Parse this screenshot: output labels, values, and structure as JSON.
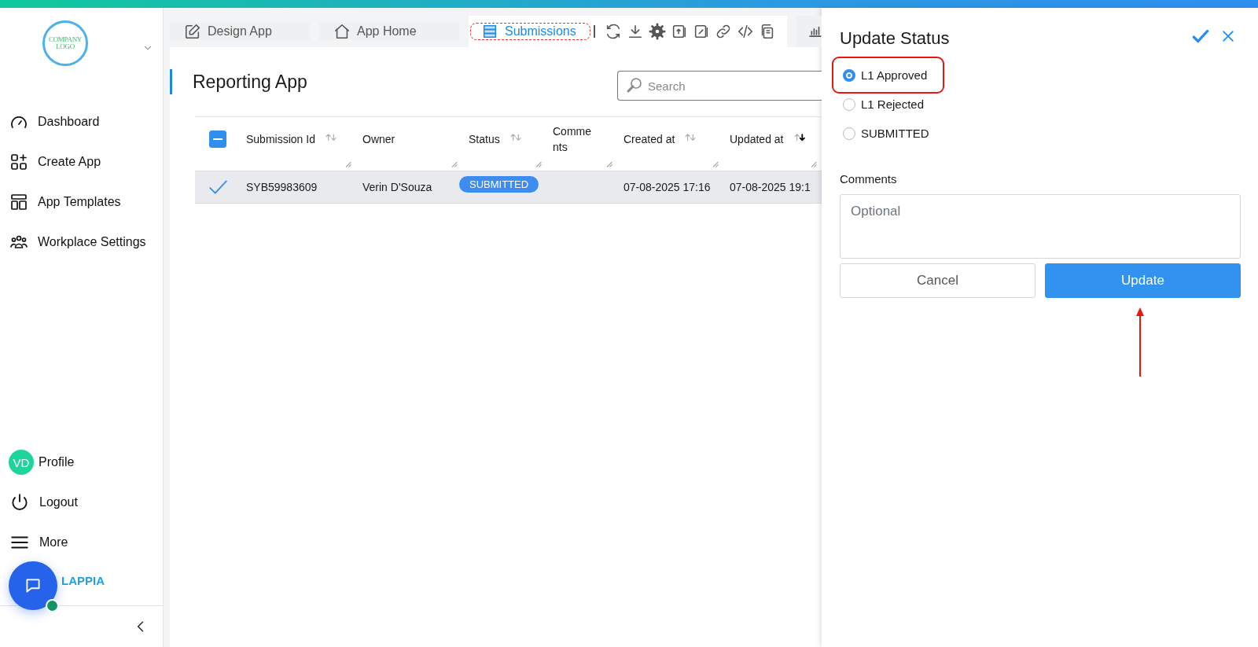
{
  "sidebar": {
    "logo_text": "COMPANY LOGO",
    "nav": [
      {
        "label": "Dashboard"
      },
      {
        "label": "Create App"
      },
      {
        "label": "App Templates"
      },
      {
        "label": "Workplace Settings"
      }
    ],
    "footer": [
      {
        "label": "Profile",
        "kind": "avatar",
        "initials": "VD"
      },
      {
        "label": "Logout",
        "kind": "power"
      },
      {
        "label": "More",
        "kind": "menu"
      }
    ],
    "brand": "LAPPIA"
  },
  "tabs": [
    {
      "label": "Design App",
      "selected": false
    },
    {
      "label": "App Home",
      "selected": false
    },
    {
      "label": "Submissions",
      "selected": true
    }
  ],
  "page": {
    "title": "Reporting App",
    "search": {
      "placeholder": "Search"
    }
  },
  "table": {
    "select_all_partial": true,
    "columns": [
      {
        "label": "Submission Id",
        "sortable": true,
        "sorted_desc": false
      },
      {
        "label": "Owner",
        "sortable": false
      },
      {
        "label": "Status",
        "sortable": true,
        "sorted_desc": false
      },
      {
        "label": "Comments",
        "sortable": false
      },
      {
        "label": "Created at",
        "sortable": true,
        "sorted_desc": false
      },
      {
        "label": "Updated at",
        "sortable": true,
        "sorted_desc": true
      }
    ],
    "rows": [
      {
        "selected": true,
        "submission_id": "SYB59983609",
        "owner": "Verin D'Souza",
        "status": "SUBMITTED",
        "created_at": "07-08-2025 17:16",
        "updated_at": "07-08-2025 19:1"
      }
    ]
  },
  "panel": {
    "title": "Update Status",
    "options": [
      {
        "label": "L1 Approved",
        "selected": true
      },
      {
        "label": "L1 Rejected",
        "selected": false
      },
      {
        "label": "SUBMITTED",
        "selected": false
      }
    ],
    "comments_label": "Comments",
    "comments_placeholder": "Optional",
    "buttons": [
      {
        "label": "Cancel",
        "kind": "secondary"
      },
      {
        "label": "Update",
        "kind": "primary"
      }
    ]
  }
}
